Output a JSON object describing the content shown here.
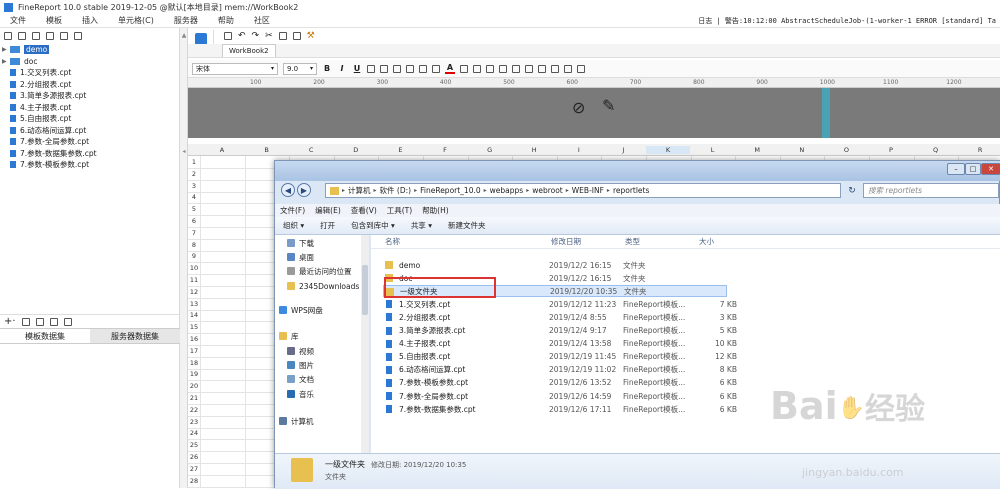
{
  "app": {
    "title": "FineReport 10.0 stable 2019-12-05 @默认[本地目录]    mem://WorkBook2",
    "menu": [
      "文件",
      "模板",
      "插入",
      "单元格(C)",
      "服务器",
      "帮助",
      "社区"
    ],
    "log": "日志 | 警告:10:12:00 AbstractScheduleJob-(1-worker-1 ERROR [standard] Ta"
  },
  "tree": {
    "folders": [
      {
        "label": "demo",
        "selected": true
      },
      {
        "label": "doc",
        "selected": false
      }
    ],
    "files": [
      "1.交叉列表.cpt",
      "2.分组报表.cpt",
      "3.简单多源报表.cpt",
      "4.主子报表.cpt",
      "5.自由报表.cpt",
      "6.动态格间运算.cpt",
      "7.参数-全局参数.cpt",
      "7.参数-数据集参数.cpt",
      "7.参数-模板参数.cpt"
    ]
  },
  "datasets": {
    "tabs": [
      "模板数据集",
      "服务器数据集"
    ]
  },
  "workbook": {
    "tab_label": "WorkBook2",
    "font_name": "宋体",
    "font_size": "9.0",
    "ruler_marks": [
      "100",
      "200",
      "300",
      "400",
      "500",
      "600",
      "700",
      "800",
      "900",
      "1000",
      "1100",
      "1200"
    ]
  },
  "sheet": {
    "columns": [
      "A",
      "B",
      "C",
      "D",
      "E",
      "F",
      "G",
      "H",
      "I",
      "J",
      "K",
      "L",
      "M",
      "N",
      "O",
      "P",
      "Q",
      "R"
    ],
    "selected_column": "K",
    "rows": [
      "1",
      "2",
      "3",
      "4",
      "5",
      "6",
      "7",
      "8",
      "9",
      "10",
      "11",
      "12",
      "13",
      "14",
      "15",
      "16",
      "17",
      "18",
      "19",
      "20",
      "21",
      "22",
      "23",
      "24",
      "25",
      "26",
      "27",
      "28"
    ]
  },
  "explorer": {
    "path": [
      "计算机",
      "软件 (D:)",
      "FineReport_10.0",
      "webapps",
      "webroot",
      "WEB-INF",
      "reportlets"
    ],
    "search_placeholder": "搜索 reportlets",
    "menu": [
      "文件(F)",
      "编辑(E)",
      "查看(V)",
      "工具(T)",
      "帮助(H)"
    ],
    "commands": [
      "组织 ▾",
      "打开",
      "包含到库中 ▾",
      "共享 ▾",
      "新建文件夹"
    ],
    "nav": [
      {
        "label": "下载",
        "color": "#7a9ac8"
      },
      {
        "label": "桌面",
        "color": "#5a86c6"
      },
      {
        "label": "最近访问的位置",
        "color": "#9a9a9a"
      },
      {
        "label": "2345Downloads",
        "color": "#e8c050"
      },
      {
        "label": "WPS网盘",
        "color": "#3c8be0"
      },
      {
        "label": "库",
        "color": "#e8c050"
      },
      {
        "label": "视频",
        "color": "#6a6a8a"
      },
      {
        "label": "图片",
        "color": "#4a86c0"
      },
      {
        "label": "文档",
        "color": "#7aa0c8"
      },
      {
        "label": "音乐",
        "color": "#2a6ab0"
      },
      {
        "label": "计算机",
        "color": "#5a7aa0"
      }
    ],
    "columns": [
      "名称",
      "修改日期",
      "类型",
      "大小"
    ],
    "files": [
      {
        "name": "demo",
        "date": "2019/12/2 16:15",
        "type": "文件夹",
        "size": "",
        "kind": "folder"
      },
      {
        "name": "doc",
        "date": "2019/12/2 16:15",
        "type": "文件夹",
        "size": "",
        "kind": "folder"
      },
      {
        "name": "一级文件夹",
        "date": "2019/12/20 10:35",
        "type": "文件夹",
        "size": "",
        "kind": "folder"
      },
      {
        "name": "1.交叉列表.cpt",
        "date": "2019/12/12 11:23",
        "type": "FineReport模板...",
        "size": "7 KB",
        "kind": "cpt"
      },
      {
        "name": "2.分组报表.cpt",
        "date": "2019/12/4 8:55",
        "type": "FineReport模板...",
        "size": "3 KB",
        "kind": "cpt"
      },
      {
        "name": "3.简单多源报表.cpt",
        "date": "2019/12/4 9:17",
        "type": "FineReport模板...",
        "size": "5 KB",
        "kind": "cpt"
      },
      {
        "name": "4.主子报表.cpt",
        "date": "2019/12/4 13:58",
        "type": "FineReport模板...",
        "size": "10 KB",
        "kind": "cpt"
      },
      {
        "name": "5.自由报表.cpt",
        "date": "2019/12/19 11:45",
        "type": "FineReport模板...",
        "size": "12 KB",
        "kind": "cpt"
      },
      {
        "name": "6.动态格间运算.cpt",
        "date": "2019/12/19 11:02",
        "type": "FineReport模板...",
        "size": "8 KB",
        "kind": "cpt"
      },
      {
        "name": "7.参数-模板参数.cpt",
        "date": "2019/12/6 13:52",
        "type": "FineReport模板...",
        "size": "6 KB",
        "kind": "cpt"
      },
      {
        "name": "7.参数-全局参数.cpt",
        "date": "2019/12/6 14:59",
        "type": "FineReport模板...",
        "size": "6 KB",
        "kind": "cpt"
      },
      {
        "name": "7.参数-数据集参数.cpt",
        "date": "2019/12/6 17:11",
        "type": "FineReport模板...",
        "size": "6 KB",
        "kind": "cpt"
      }
    ],
    "highlighted_index": 2,
    "details": {
      "name": "一级文件夹",
      "date_label": "修改日期: 2019/12/20 10:35",
      "type": "文件夹"
    }
  },
  "watermark": {
    "brand": "Bai",
    "brand2": "经验",
    "url": "jingyan.baidu.com"
  }
}
